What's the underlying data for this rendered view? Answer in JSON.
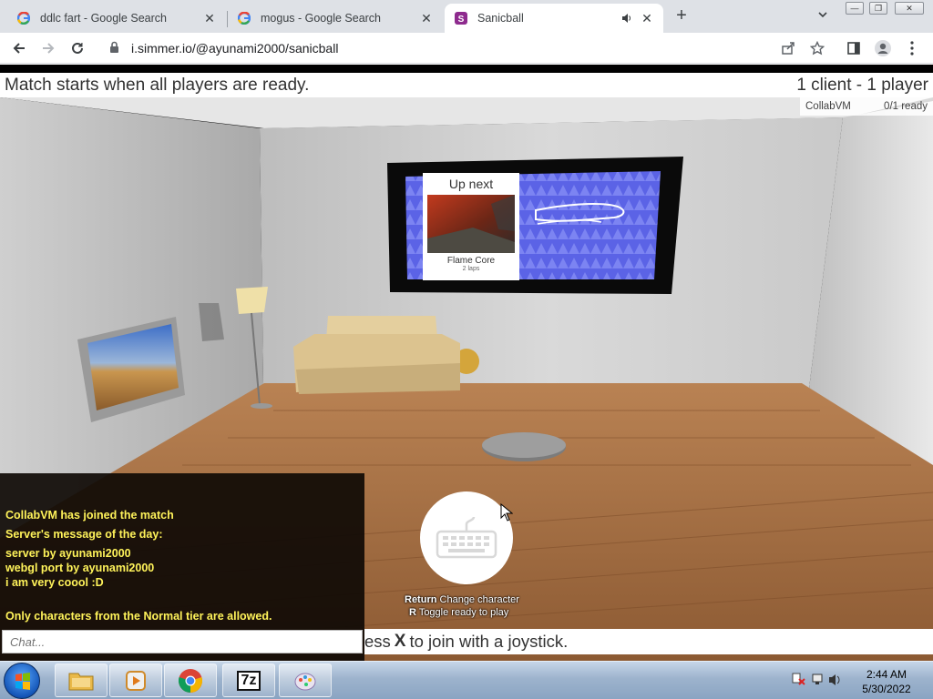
{
  "browser": {
    "tabs": [
      {
        "title": "ddlc fart - Google Search",
        "favicon": "google-g-icon"
      },
      {
        "title": "mogus - Google Search",
        "favicon": "google-g-icon"
      },
      {
        "title": "Sanicball",
        "favicon": "sanicball-s-icon",
        "active": true,
        "audio": "speaker-icon"
      }
    ],
    "url": "i.simmer.io/@ayunami2000/sanicball"
  },
  "game": {
    "status_left": "Match starts when all players are ready.",
    "status_right": "1 client - 1 player",
    "player_name": "CollabVM",
    "player_ready": "0/1 ready",
    "up_next": {
      "title": "Up next",
      "map_name": "Flame Core",
      "laps": "2 laps"
    },
    "chat": {
      "messages": [
        "CollabVM has joined the match",
        "Server's message of the day:",
        "server by ayunami2000",
        "webgl port by ayunami2000",
        "i am very coool :D",
        "Only characters from the Normal tier are allowed."
      ],
      "placeholder": "Chat..."
    },
    "join_prefix": "ess",
    "join_key": "X",
    "join_suffix": "to join with a joystick.",
    "hints": [
      {
        "key": "Return",
        "text": "Change character"
      },
      {
        "key": "R",
        "text": "Toggle ready to play"
      }
    ]
  },
  "taskbar": {
    "time": "2:44 AM",
    "date": "5/30/2022",
    "apps": [
      "explorer-icon",
      "media-player-icon",
      "chrome-icon",
      "7zip-icon",
      "paint-icon"
    ],
    "app_7z_label": "7z"
  }
}
